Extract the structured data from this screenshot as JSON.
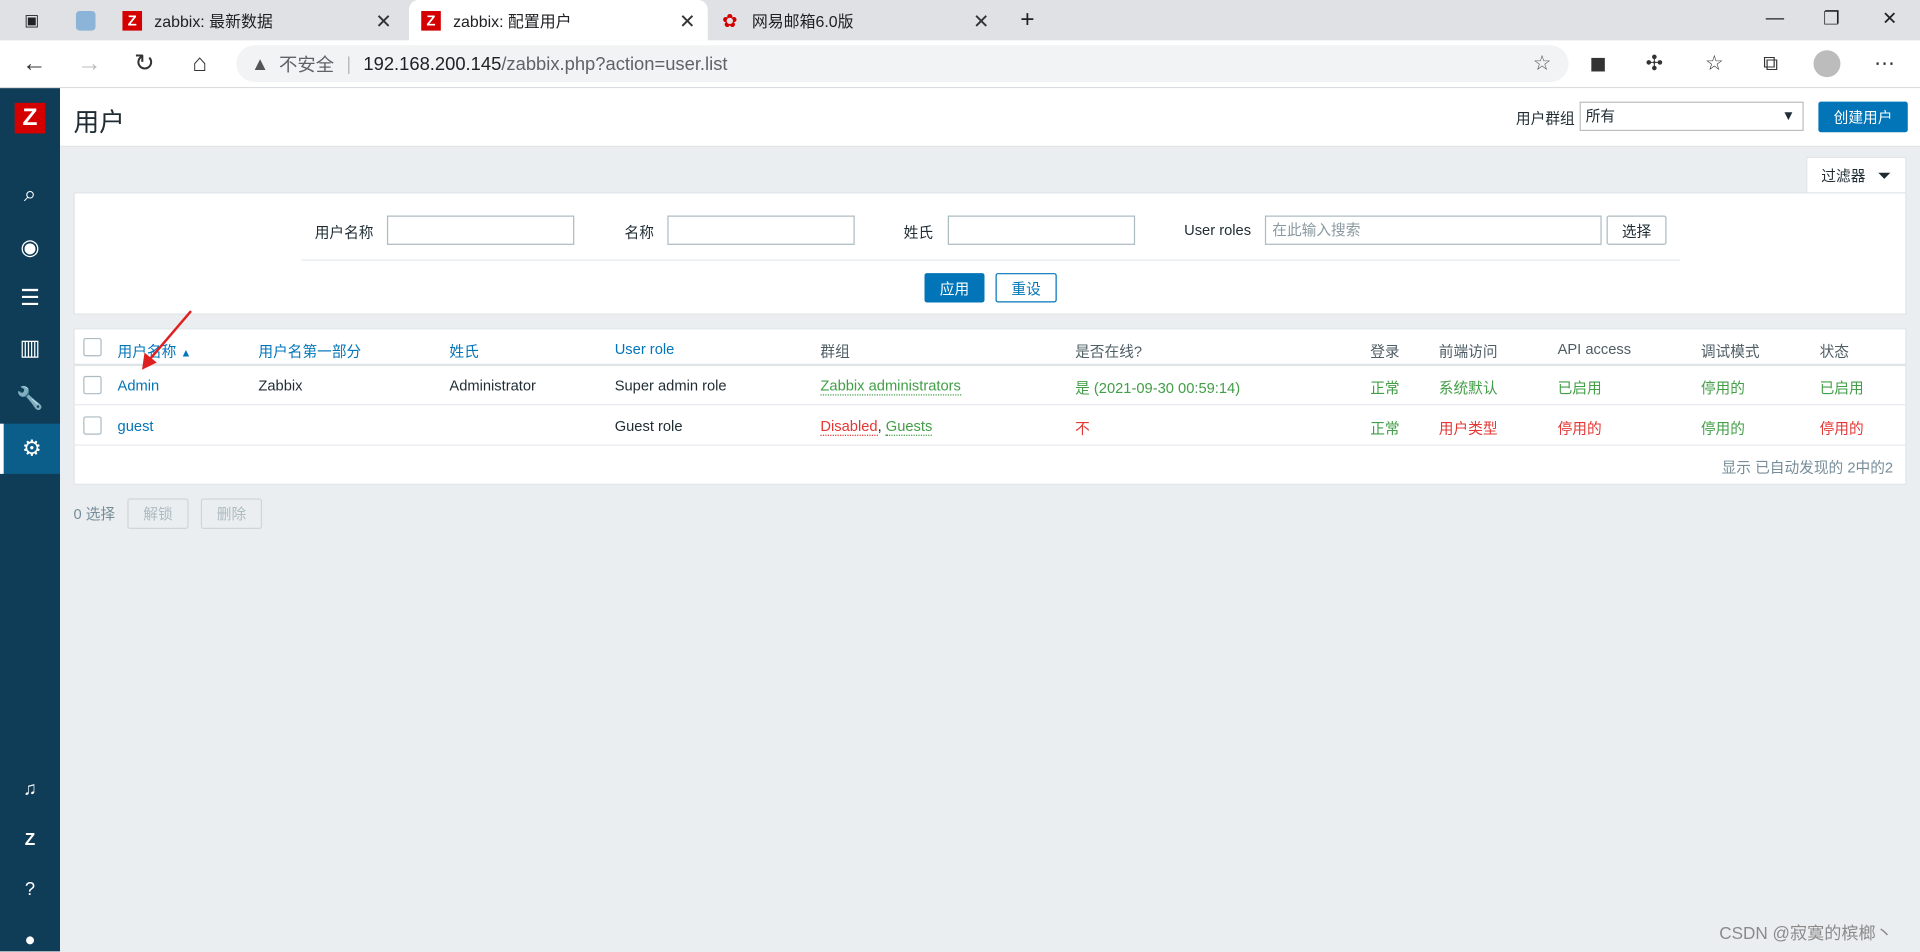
{
  "browser": {
    "tabs": [
      {
        "title": ""
      },
      {
        "title": "zabbix: 最新数据"
      },
      {
        "title": "zabbix: 配置用户"
      },
      {
        "title": "网易邮箱6.0版"
      }
    ],
    "security": "不安全",
    "url_host": "192.168.200.145",
    "url_path": "/zabbix.php?action=user.list"
  },
  "header": {
    "title": "用户",
    "group_label": "用户群组",
    "group_value": "所有",
    "create_button": "创建用户"
  },
  "filter": {
    "tab_label": "过滤器",
    "username_label": "用户名称",
    "name_label": "名称",
    "surname_label": "姓氏",
    "roles_label": "User roles",
    "roles_placeholder": "在此输入搜索",
    "select_button": "选择",
    "apply_button": "应用",
    "reset_button": "重设"
  },
  "table": {
    "columns": [
      "用户名称",
      "用户名第一部分",
      "姓氏",
      "User role",
      "群组",
      "是否在线?",
      "登录",
      "前端访问",
      "API access",
      "调试模式",
      "状态"
    ],
    "sort_indicator": "▲",
    "rows": [
      {
        "username": "Admin",
        "name": "Zabbix",
        "surname": "Administrator",
        "role": "Super admin role",
        "group1": "Zabbix administrators",
        "group_sep": "",
        "group2": "",
        "online": "是 (2021-09-30 00:59:14)",
        "login": "正常",
        "frontend": "系统默认",
        "api": "已启用",
        "debug": "停用的",
        "status": "已启用"
      },
      {
        "username": "guest",
        "name": "",
        "surname": "",
        "role": "Guest role",
        "group1": "Disabled",
        "group_sep": ", ",
        "group2": "Guests",
        "online": "不",
        "login": "正常",
        "frontend": "用户类型",
        "api": "停用的",
        "debug": "停用的",
        "status": "停用的"
      }
    ],
    "footer": "显示 已自动发现的 2中的2"
  },
  "actions": {
    "selected": "0 选择",
    "unlock": "解锁",
    "delete": "删除"
  },
  "watermark": "CSDN @寂寞的槟榔丶",
  "colors": {
    "brand": "#d40000",
    "sidebar": "#0f3c57",
    "link": "#0275b8",
    "green": "#429e47",
    "red": "#e33734"
  }
}
